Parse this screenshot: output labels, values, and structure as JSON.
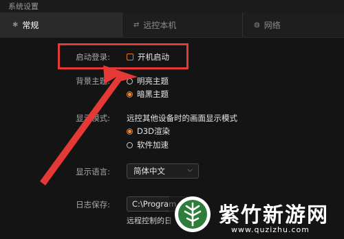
{
  "window": {
    "title": "系统设置"
  },
  "tabs": [
    {
      "label": "常规",
      "icon": "gear-icon"
    },
    {
      "label": "远控本机",
      "icon": "remote-icon"
    },
    {
      "label": "网络",
      "icon": "network-icon"
    }
  ],
  "settings": {
    "startup": {
      "label": "启动登录:",
      "option": "开机启动"
    },
    "theme": {
      "label": "背景主题:",
      "options": [
        "明亮主题",
        "暗黑主题"
      ],
      "selected": "暗黑主题"
    },
    "display_mode": {
      "label": "显示模式:",
      "description": "远控其他设备时的画面显示模式",
      "options": [
        "D3D渲染",
        "软件加速"
      ],
      "selected": "D3D渲染"
    },
    "language": {
      "label": "显示语言:",
      "value": "简体中文"
    },
    "log": {
      "label": "日志保存:",
      "path": "C:\\Program",
      "hint": "远程控制的日"
    }
  },
  "watermark": {
    "name": "紫竹新游网",
    "url": "www.quzizhu.com"
  },
  "colors": {
    "accent": "#e88a3a",
    "highlight": "#e53935",
    "background": "#141414"
  }
}
